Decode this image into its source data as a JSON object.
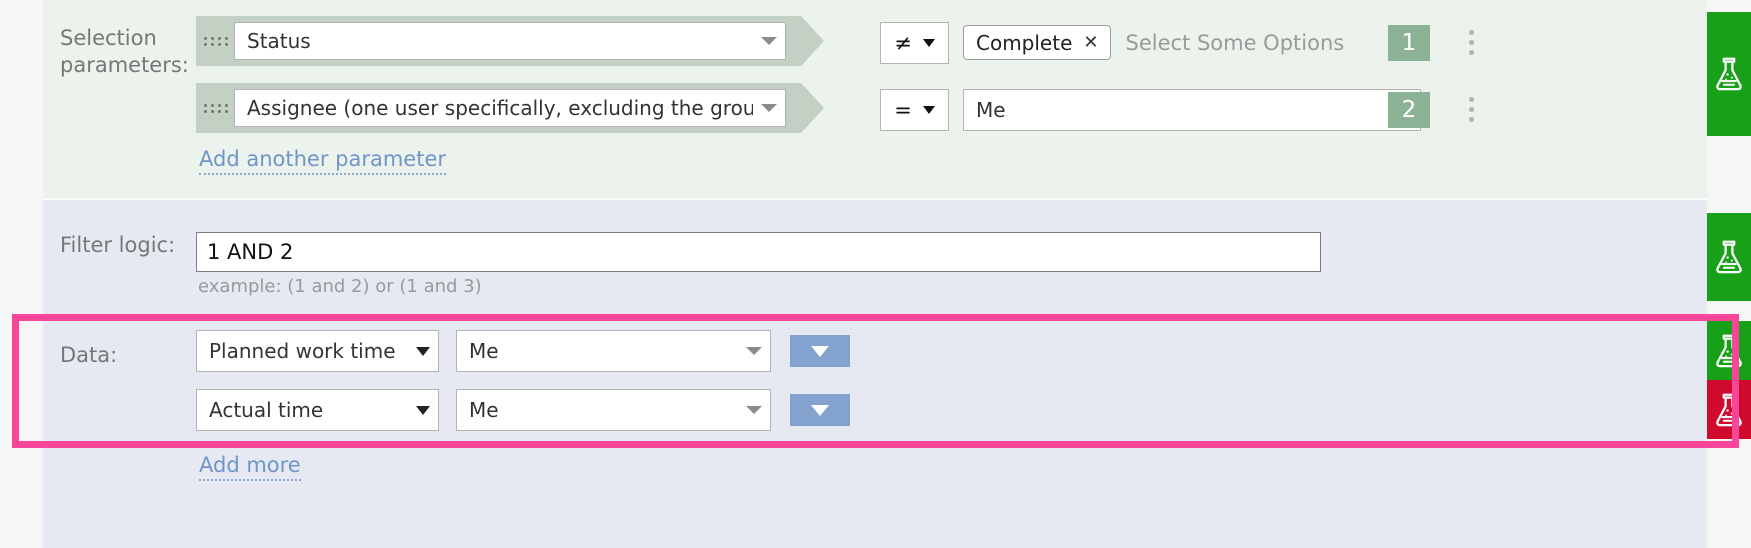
{
  "selection": {
    "label": "Selection parameters:",
    "rows": [
      {
        "field": "Status",
        "operator": "≠",
        "value_chip": "Complete",
        "chip_remove": "✕",
        "value_placeholder": "Select Some Options",
        "badge": "1"
      },
      {
        "field": "Assignee (one user specifically, excluding the group the",
        "operator": "=",
        "value": "Me",
        "badge": "2"
      }
    ],
    "add_link": "Add another parameter"
  },
  "filter_logic": {
    "label": "Filter logic:",
    "value": "1 AND 2",
    "hint": "example: (1 and 2) or (1 and 3)"
  },
  "data": {
    "label": "Data:",
    "rows": [
      {
        "metric": "Planned work time",
        "scope": "Me"
      },
      {
        "metric": "Actual time",
        "scope": "Me"
      }
    ],
    "add_link": "Add more"
  },
  "icons": {
    "flask": "flask-icon",
    "grip": "drag-handle-icon",
    "kebab": "more-options-icon",
    "caret": "chevron-down-icon"
  },
  "colors": {
    "selection_bg": "#ecf2ec",
    "data_bg": "#e6e9f2",
    "capsule": "#c3d1c5",
    "badge": "#8cb396",
    "flask_green": "#18a018",
    "flask_red": "#cf0a2c",
    "blue_button": "#84a2ce",
    "highlight": "#f9469b",
    "link": "#6f95c9"
  }
}
